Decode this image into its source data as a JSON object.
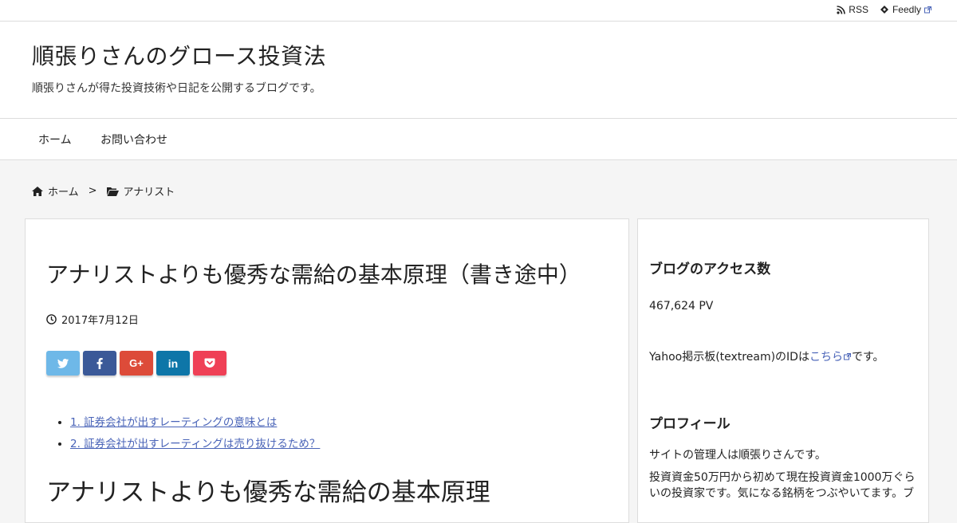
{
  "topbar": {
    "rss_label": "RSS",
    "feedly_label": "Feedly"
  },
  "header": {
    "site_title": "順張りさんのグロース投資法",
    "site_description": "順張りさんが得た投資技術や日記を公開するブログです。"
  },
  "nav": {
    "items": [
      {
        "label": "ホーム"
      },
      {
        "label": "お問い合わせ"
      }
    ]
  },
  "breadcrumb": {
    "home_label": "ホーム",
    "separator": ">",
    "category_label": "アナリスト"
  },
  "post": {
    "title": "アナリストよりも優秀な需給の基本原理（書き途中）",
    "date": "2017年7月12日",
    "toc": [
      {
        "text": "1. 証券会社が出すレーティングの意味とは"
      },
      {
        "text": "2. 証券会社が出すレーティングは売り抜けるため？"
      }
    ],
    "heading": "アナリストよりも優秀な需給の基本原理"
  },
  "share_buttons": [
    {
      "icon": "twitter-icon",
      "color": "#6eb8e8",
      "glyph": "🐦"
    },
    {
      "icon": "facebook-icon",
      "color": "#3b5998",
      "glyph": "f"
    },
    {
      "icon": "google-plus-icon",
      "color": "#dd4b39",
      "glyph": "G+"
    },
    {
      "icon": "linkedin-icon",
      "color": "#0e76a8",
      "glyph": "in"
    },
    {
      "icon": "pocket-icon",
      "color": "#ef4056",
      "glyph": "✓"
    }
  ],
  "sidebar": {
    "access_title": "ブログのアクセス数",
    "access_count": "467,624 PV",
    "yahoo_text_before": "Yahoo掲示板(textream)のIDは",
    "yahoo_link": "こちら",
    "yahoo_text_after": "です。",
    "profile_title": "プロフィール",
    "profile_line1": "サイトの管理人は順張りさんです。",
    "profile_line2": "投資資金50万円から初めて現在投資資金1000万ぐらいの投資家です。気になる銘柄をつぶやいてます。ブ"
  }
}
